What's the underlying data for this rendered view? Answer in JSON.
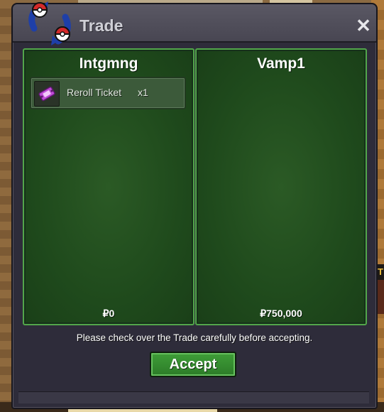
{
  "window": {
    "title": "Trade",
    "close_glyph": "✕"
  },
  "panels": [
    {
      "player": "Intgmng",
      "items": [
        {
          "name": "Reroll Ticket",
          "quantity": "x1",
          "icon": "ticket-icon"
        }
      ],
      "money": "₽0"
    },
    {
      "player": "Vamp1",
      "items": [],
      "money": "₽750,000"
    }
  ],
  "notice": "Please check over the Trade carefully before accepting.",
  "accept_label": "Accept",
  "colors": {
    "panel_green": "#1f4a1c",
    "panel_border": "#52a64a",
    "button_green": "#2c7b28",
    "window_bg": "#2e2c3a"
  }
}
